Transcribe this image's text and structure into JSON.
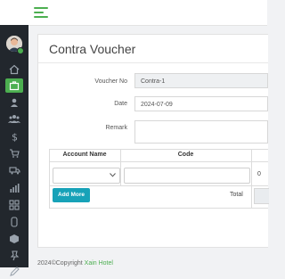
{
  "app": {
    "accent_color": "#4caf50",
    "sidebar_color": "#22272d"
  },
  "header": {
    "menu_icon": "hamburger-icon"
  },
  "sidebar": {
    "items": [
      {
        "icon": "home-icon"
      },
      {
        "icon": "briefcase-icon",
        "active": true
      },
      {
        "icon": "user-icon"
      },
      {
        "icon": "users-icon"
      },
      {
        "icon": "dollar-icon"
      },
      {
        "icon": "cart-icon"
      },
      {
        "icon": "truck-icon"
      },
      {
        "icon": "bar-chart-icon"
      },
      {
        "icon": "grid-icon"
      },
      {
        "icon": "toggle-icon"
      },
      {
        "icon": "cube-icon"
      },
      {
        "icon": "pin-icon"
      },
      {
        "icon": "pencil-icon"
      }
    ]
  },
  "page": {
    "title": "Contra Voucher"
  },
  "form": {
    "voucher_no_label": "Voucher No",
    "voucher_no_value": "Contra-1",
    "date_label": "Date",
    "date_value": "2024-07-09",
    "remark_label": "Remark",
    "remark_value": ""
  },
  "table": {
    "headers": [
      "Account Name",
      "Code"
    ],
    "row": {
      "account": "",
      "code": "",
      "amount": "0"
    },
    "add_more_label": "Add More",
    "total_label": "Total"
  },
  "footer": {
    "copyright": "2024©Copyright",
    "brand": "Xain Hotel"
  }
}
